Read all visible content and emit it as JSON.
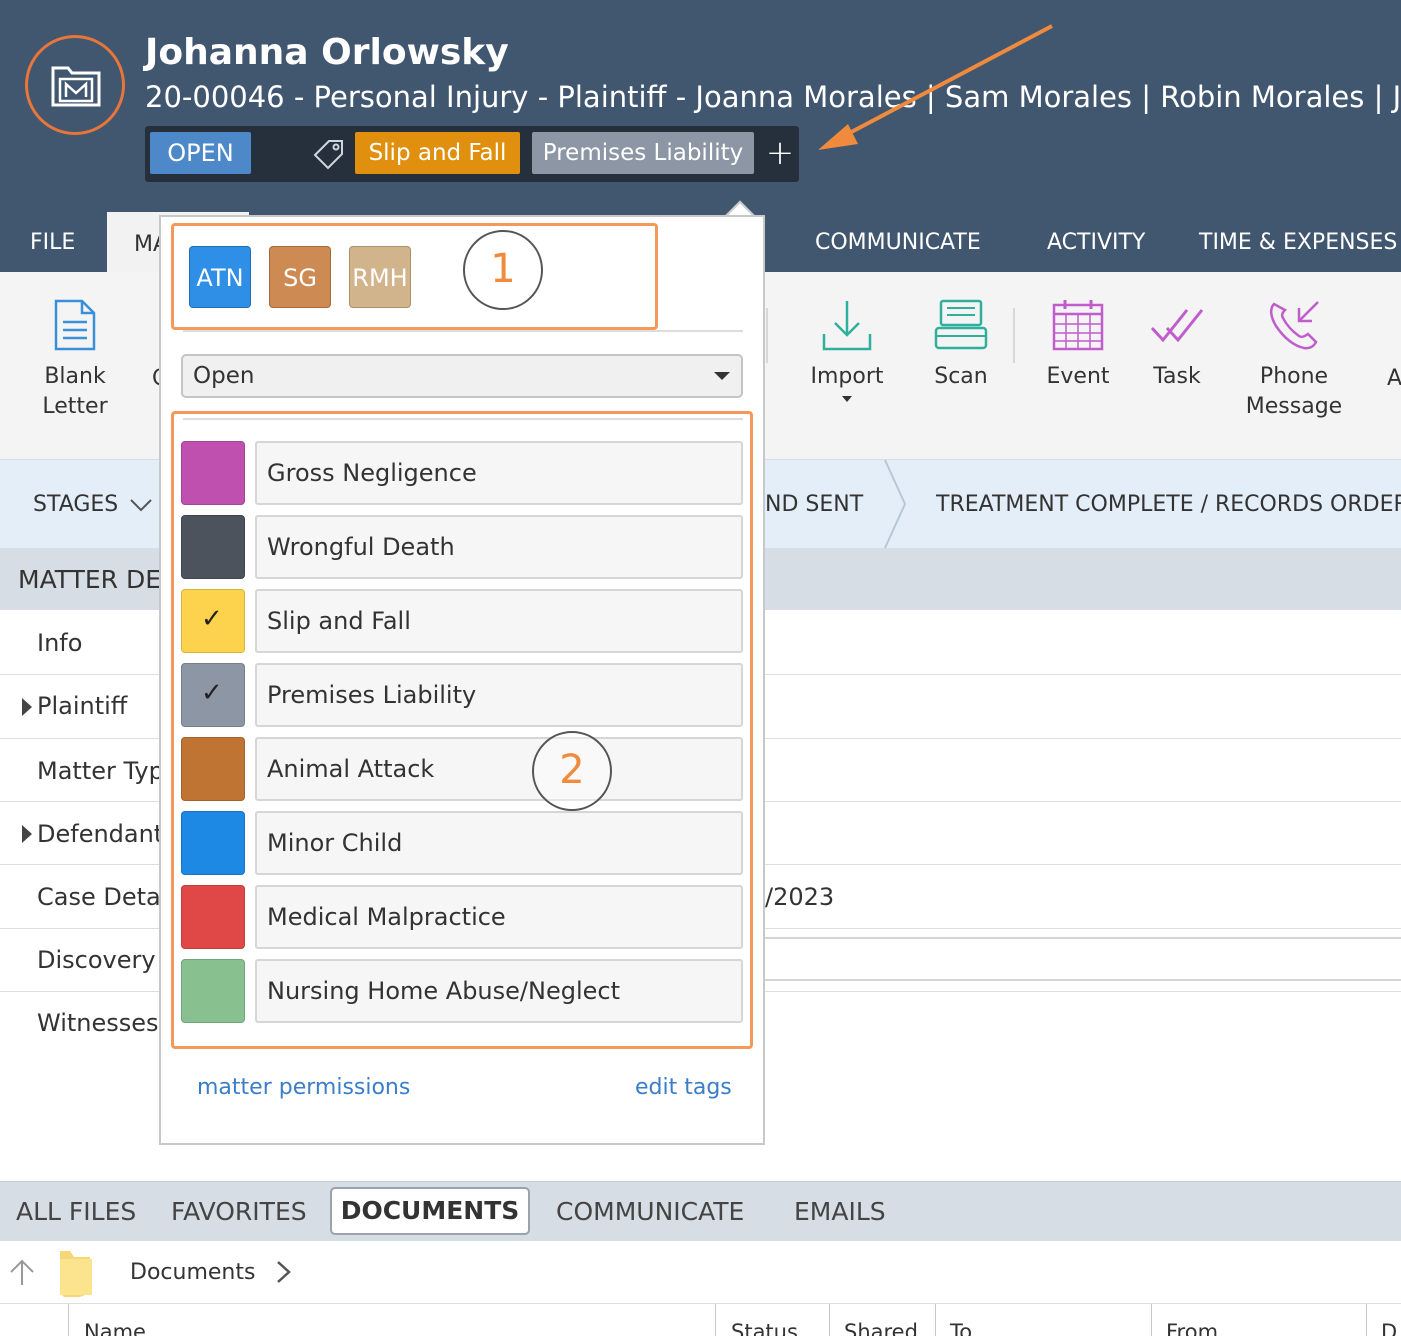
{
  "header": {
    "client_name": "Johanna Orlowsky",
    "matter_line": "20-00046 - Personal Injury - Plaintiff - Joanna Morales | Sam Morales | Robin Morales | James M",
    "status": "OPEN",
    "tags": [
      "Slip and Fall",
      "Premises Liability"
    ],
    "add_tag": "+"
  },
  "menu": {
    "file": "FILE",
    "matter": "MA",
    "communicate": "COMMUNICATE",
    "activity": "ACTIVITY",
    "time_expenses": "TIME & EXPENSES"
  },
  "ribbon": {
    "blank_letter": [
      "Blank",
      "Letter"
    ],
    "partial_c": "C",
    "import": "Import",
    "scan": "Scan",
    "event": "Event",
    "task": "Task",
    "phone_message": [
      "Phone",
      "Message"
    ],
    "partial_a": "A"
  },
  "stages": {
    "label": "STAGES",
    "stage_sent": "ND SENT",
    "stage_treatment": "TREATMENT COMPLETE / RECORDS ORDERE"
  },
  "matter_details": {
    "title": "MATTER DE",
    "rows": [
      "Info",
      "Plaintiff",
      "Matter Typ",
      "Defendant",
      "Case Detai",
      "Discovery I",
      "Witnesses"
    ],
    "partial_date": "/2023"
  },
  "popup": {
    "users": [
      {
        "initials": "ATN",
        "color": "#2f8fe6"
      },
      {
        "initials": "SG",
        "color": "#cd8a52"
      },
      {
        "initials": "RMH",
        "color": "#d2b48c"
      }
    ],
    "status_value": "Open",
    "tags": [
      {
        "name": "Gross Negligence",
        "color": "#c050b0",
        "checked": false
      },
      {
        "name": "Wrongful Death",
        "color": "#4d535c",
        "checked": false
      },
      {
        "name": "Slip and Fall",
        "color": "#fdd34d",
        "checked": true
      },
      {
        "name": "Premises Liability",
        "color": "#8c96a4",
        "checked": true
      },
      {
        "name": "Animal Attack",
        "color": "#c07433",
        "checked": false
      },
      {
        "name": "Minor Child",
        "color": "#1e88e5",
        "checked": false
      },
      {
        "name": "Medical Malpractice",
        "color": "#e04848",
        "checked": false
      },
      {
        "name": "Nursing Home Abuse/Neglect",
        "color": "#88c090",
        "checked": false
      }
    ],
    "checkmark": "✓",
    "matter_permissions": "matter permissions",
    "edit_tags": "edit tags"
  },
  "annotations": {
    "one": "1",
    "two": "2"
  },
  "bottom_tabs": {
    "all_files": "ALL FILES",
    "favorites": "FAVORITES",
    "documents": "DOCUMENTS",
    "communicate": "COMMUNICATE",
    "emails": "EMAILS"
  },
  "path": {
    "folder": "Documents"
  },
  "table": {
    "name": "Name",
    "status": "Status",
    "shared": "Shared",
    "to": "To",
    "from": "From",
    "partial_d": "D"
  },
  "colors": {
    "header_bg": "#41566f",
    "accent_orange": "#e8753a",
    "open_badge": "#4d89c8",
    "tag_slip": "#e0900e",
    "tag_premises": "#8c96a4",
    "link_blue": "#3a7ec8",
    "highlight_orange": "#f39a5a"
  }
}
